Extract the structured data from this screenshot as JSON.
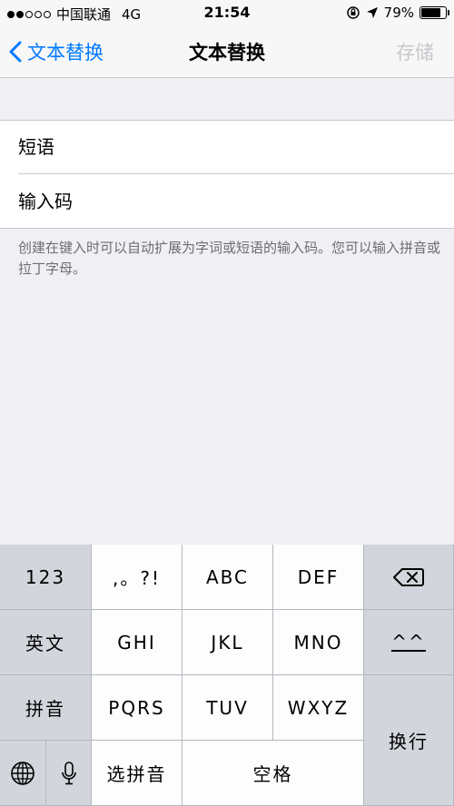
{
  "status_bar": {
    "carrier": "中国联通",
    "network": "4G",
    "time": "21:54",
    "battery_percent": "79%",
    "battery_level": 0.79
  },
  "nav": {
    "back_label": "文本替换",
    "title": "文本替换",
    "save_label": "存储"
  },
  "form": {
    "phrase_placeholder": "短语",
    "shortcut_placeholder": "输入码",
    "footer": "创建在键入时可以自动扩展为字词或短语的输入码。您可以输入拼音或拉丁字母。"
  },
  "keyboard": {
    "row1": [
      "123",
      ",。?!",
      "ABC",
      "DEF"
    ],
    "row2": [
      "英文",
      "GHI",
      "JKL",
      "MNO",
      "^^"
    ],
    "row3": [
      "拼音",
      "PQRS",
      "TUV",
      "WXYZ"
    ],
    "select_pinyin": "选拼音",
    "space": "空格",
    "return": "换行"
  },
  "colors": {
    "accent": "#007aff",
    "disabled": "#c7c7cc",
    "background": "#efeff4"
  }
}
